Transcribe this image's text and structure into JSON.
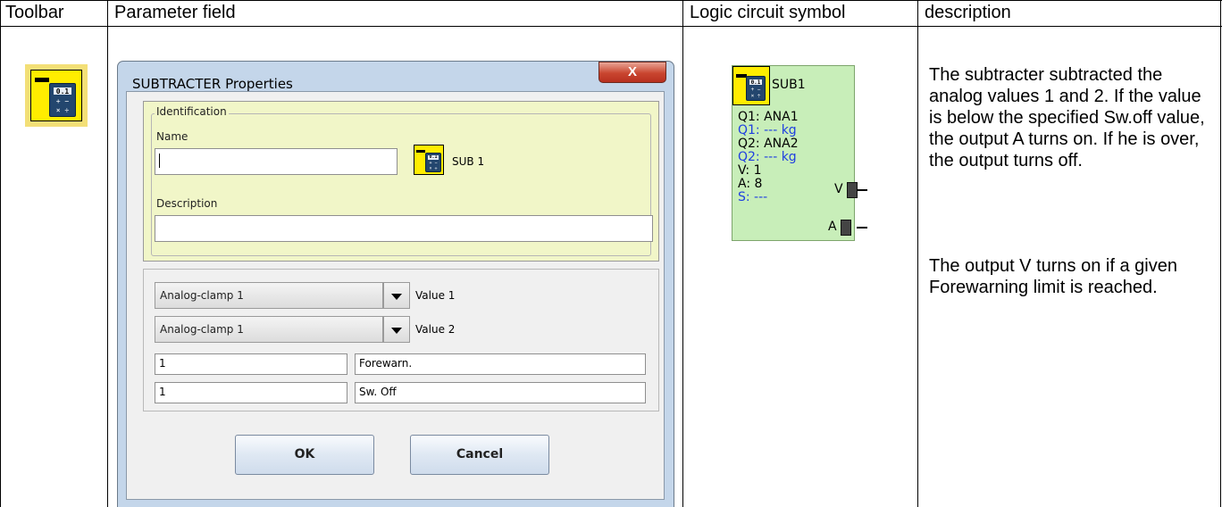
{
  "headers": {
    "toolbar": "Toolbar",
    "parameter_field": "Parameter field",
    "logic_symbol": "Logic circuit symbol",
    "description": "description"
  },
  "toolbar_icon": {
    "name": "subtracter-calculator-icon"
  },
  "dialog": {
    "title": "SUBTRACTER Properties",
    "close_label": "X",
    "identification": {
      "legend": "Identification",
      "name_label": "Name",
      "name_value": "",
      "block_label": "SUB 1",
      "description_label": "Description",
      "description_value": ""
    },
    "inputs": [
      {
        "selected": "Analog-clamp 1",
        "label": "Value 1"
      },
      {
        "selected": "Analog-clamp 1",
        "label": "Value 2"
      }
    ],
    "limits": [
      {
        "value": "1",
        "label": "Forewarn."
      },
      {
        "value": "1",
        "label": "Sw. Off"
      }
    ],
    "ok_label": "OK",
    "cancel_label": "Cancel"
  },
  "symbol": {
    "title": "SUB1",
    "lines": [
      {
        "text": "Q1: ANA1",
        "color": "#000000"
      },
      {
        "text": "Q1: --- kg",
        "color": "#1f3fe0"
      },
      {
        "text": "Q2: ANA2",
        "color": "#000000"
      },
      {
        "text": "Q2: --- kg",
        "color": "#1f3fe0"
      },
      {
        "text": "V: 1",
        "color": "#000000"
      },
      {
        "text": "A: 8",
        "color": "#000000"
      },
      {
        "text": "S: ---",
        "color": "#1f3fe0"
      }
    ],
    "outputs": [
      "V",
      "A"
    ],
    "background": "#c8eeb9"
  },
  "description": {
    "paragraph1": "The subtracter subtracted the analog values 1 and 2. If the value is below the specified Sw.off value, the output A turns on. If he is over, the output turns off.",
    "paragraph2": "The output V turns on if a given Forewarning limit is reached."
  }
}
